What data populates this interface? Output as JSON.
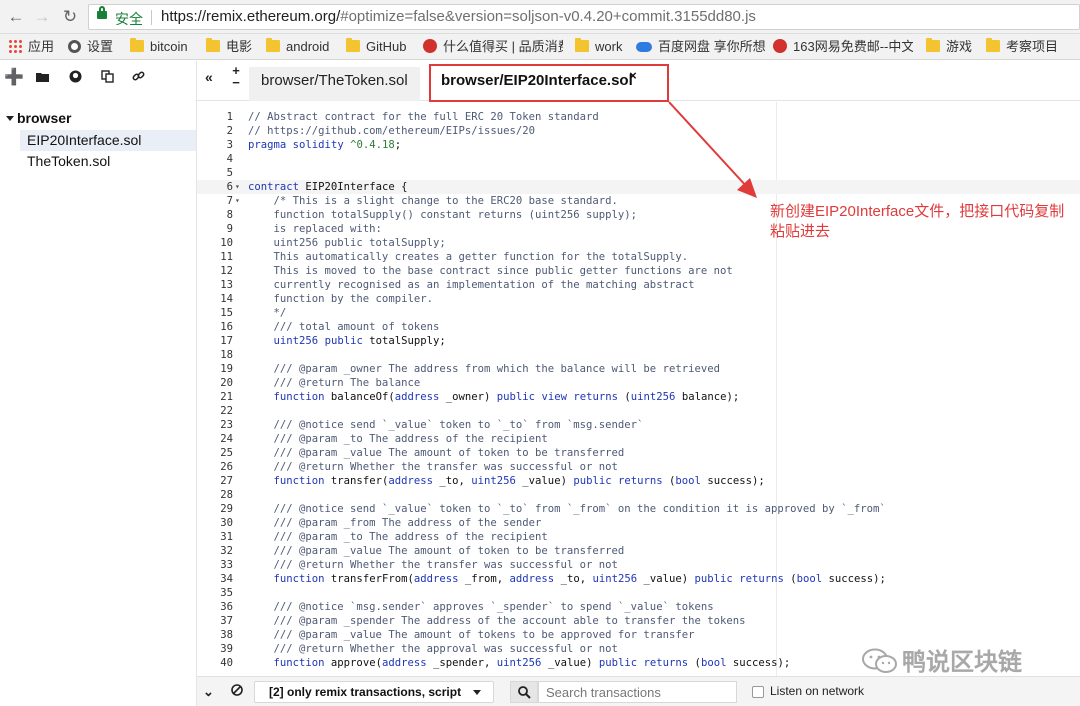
{
  "browser": {
    "secure_label": "安全",
    "url_host": "https://remix.ethereum.org/",
    "url_rest": "#optimize=false&version=soljson-v0.4.20+commit.3155dd80.js",
    "bookmarks": [
      {
        "label": "应用",
        "icon": "apps-icon"
      },
      {
        "label": "设置",
        "icon": "gear-icon"
      },
      {
        "label": "bitcoin",
        "icon": "folder-icon"
      },
      {
        "label": "电影",
        "icon": "folder-icon"
      },
      {
        "label": "android",
        "icon": "folder-icon"
      },
      {
        "label": "GitHub",
        "icon": "folder-icon"
      },
      {
        "label": "什么值得买 | 品质消费",
        "icon": "smzdm-icon"
      },
      {
        "label": "work",
        "icon": "folder-icon"
      },
      {
        "label": "百度网盘 享你所想",
        "icon": "baidu-cloud-icon"
      },
      {
        "label": "163网易免费邮--中文",
        "icon": "netease-icon"
      },
      {
        "label": "游戏",
        "icon": "folder-icon"
      },
      {
        "label": "考察项目",
        "icon": "folder-icon"
      }
    ]
  },
  "explorer": {
    "root": "browser",
    "files": [
      "EIP20Interface.sol",
      "TheToken.sol"
    ],
    "active_index": 0
  },
  "tabs": [
    {
      "label": "browser/TheToken.sol",
      "active": false
    },
    {
      "label": "browser/EIP20Interface.sol",
      "active": true,
      "close": "×"
    }
  ],
  "editor": {
    "highlight_line": 6,
    "fold_lines": [
      6,
      7
    ],
    "lines": [
      "// Abstract contract for the full ERC 20 Token standard",
      "// https://github.com/ethereum/EIPs/issues/20",
      "pragma solidity ^0.4.18;",
      "",
      "",
      "contract EIP20Interface {",
      "    /* This is a slight change to the ERC20 base standard.",
      "    function totalSupply() constant returns (uint256 supply);",
      "    is replaced with:",
      "    uint256 public totalSupply;",
      "    This automatically creates a getter function for the totalSupply.",
      "    This is moved to the base contract since public getter functions are not",
      "    currently recognised as an implementation of the matching abstract",
      "    function by the compiler.",
      "    */",
      "    /// total amount of tokens",
      "    uint256 public totalSupply;",
      "",
      "    /// @param _owner The address from which the balance will be retrieved",
      "    /// @return The balance",
      "    function balanceOf(address _owner) public view returns (uint256 balance);",
      "",
      "    /// @notice send `_value` token to `_to` from `msg.sender`",
      "    /// @param _to The address of the recipient",
      "    /// @param _value The amount of token to be transferred",
      "    /// @return Whether the transfer was successful or not",
      "    function transfer(address _to, uint256 _value) public returns (bool success);",
      "",
      "    /// @notice send `_value` token to `_to` from `_from` on the condition it is approved by `_from`",
      "    /// @param _from The address of the sender",
      "    /// @param _to The address of the recipient",
      "    /// @param _value The amount of token to be transferred",
      "    /// @return Whether the transfer was successful or not",
      "    function transferFrom(address _from, address _to, uint256 _value) public returns (bool success);",
      "",
      "    /// @notice `msg.sender` approves `_spender` to spend `_value` tokens",
      "    /// @param _spender The address of the account able to transfer the tokens",
      "    /// @param _value The amount of tokens to be approved for transfer",
      "    /// @return Whether the approval was successful or not",
      "    function approve(address _spender, uint256 _value) public returns (bool success);"
    ]
  },
  "annotation": {
    "text": "新创建EIP20Interface文件，把接口代码复制粘贴进去",
    "color": "#e03a3a"
  },
  "watermark": {
    "text": "鸭说区块链"
  },
  "terminal": {
    "filter_label": "[2] only remix transactions, script",
    "search_placeholder": "Search transactions",
    "listen_label": "Listen on network"
  }
}
